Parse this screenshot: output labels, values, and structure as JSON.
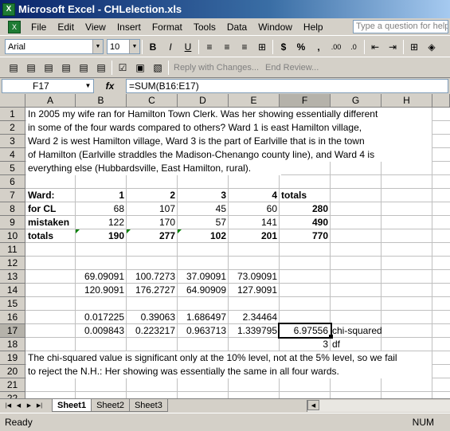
{
  "window": {
    "title": "Microsoft Excel - CHLelection.xls"
  },
  "menu": {
    "items": [
      "File",
      "Edit",
      "View",
      "Insert",
      "Format",
      "Tools",
      "Data",
      "Window",
      "Help"
    ],
    "help_placeholder": "Type a question for help"
  },
  "toolbar": {
    "font": "Arial",
    "size": "10",
    "bold": "B",
    "italic": "I",
    "underline": "U",
    "currency": "$",
    "percent": "%",
    "comma": ",",
    "inc_decimal": ".00",
    "dec_decimal": ".0",
    "reply": "Reply with Changes...",
    "end_review": "End Review..."
  },
  "formula_bar": {
    "cell_ref": "F17",
    "fx": "fx",
    "formula": "=SUM(B16:E17)"
  },
  "columns": [
    "A",
    "B",
    "C",
    "D",
    "E",
    "F",
    "G",
    "H"
  ],
  "rows": [
    "1",
    "2",
    "3",
    "4",
    "5",
    "6",
    "7",
    "8",
    "9",
    "10",
    "11",
    "12",
    "13",
    "14",
    "15",
    "16",
    "17",
    "18",
    "19",
    "20",
    "21",
    "22"
  ],
  "text_rows": {
    "r1": "In 2005 my wife ran for Hamilton Town Clerk.  Was her showing essentially different",
    "r2": "in some of the four wards compared to others?  Ward 1 is east Hamilton village,",
    "r3": "Ward 2 is west Hamilton village, Ward 3 is the part of Earlville that is in the town",
    "r4": "of Hamilton (Earlville straddles the Madison-Chenango county line), and Ward 4 is",
    "r5": "everything else (Hubbardsville, East Hamilton, rural).",
    "r19": "The chi-squared value is significant only at the 10% level, not at the 5% level, so we fail",
    "r20": "to reject the N.H.: Her showing was essentially the same in all four wards."
  },
  "table": {
    "r7": {
      "a": "Ward:",
      "b": "1",
      "c": "2",
      "d": "3",
      "e": "4",
      "f": "totals"
    },
    "r8": {
      "a": "for CL",
      "b": "68",
      "c": "107",
      "d": "45",
      "e": "60",
      "f": "280"
    },
    "r9": {
      "a": "mistaken",
      "b": "122",
      "c": "170",
      "d": "57",
      "e": "141",
      "f": "490"
    },
    "r10": {
      "a": "totals",
      "b": "190",
      "c": "277",
      "d": "102",
      "e": "201",
      "f": "770"
    },
    "r13": {
      "b": "69.09091",
      "c": "100.7273",
      "d": "37.09091",
      "e": "73.09091"
    },
    "r14": {
      "b": "120.9091",
      "c": "176.2727",
      "d": "64.90909",
      "e": "127.9091"
    },
    "r16": {
      "b": "0.017225",
      "c": "0.39063",
      "d": "1.686497",
      "e": "2.34464"
    },
    "r17": {
      "b": "0.009843",
      "c": "0.223217",
      "d": "0.963713",
      "e": "1.339795",
      "f": "6.97556",
      "g": "chi-squared"
    },
    "r18": {
      "f": "3",
      "g": "df"
    }
  },
  "tabs": [
    "Sheet1",
    "Sheet2",
    "Sheet3"
  ],
  "status": {
    "left": "Ready",
    "right": "NUM"
  }
}
